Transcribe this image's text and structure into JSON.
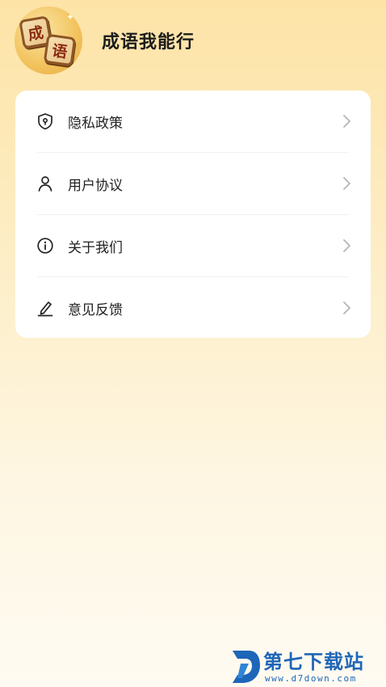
{
  "app": {
    "title": "成语我能行",
    "logo_chars": [
      "成",
      "语"
    ]
  },
  "menu": {
    "items": [
      {
        "label": "隐私政策",
        "icon": "shield-icon"
      },
      {
        "label": "用户协议",
        "icon": "user-icon"
      },
      {
        "label": "关于我们",
        "icon": "info-icon"
      },
      {
        "label": "意见反馈",
        "icon": "edit-icon"
      }
    ]
  },
  "watermark": {
    "brand": "第七下载站",
    "url": "www.d7down.com"
  },
  "colors": {
    "background_top": "#fde3a6",
    "background_bottom": "#fffbf2",
    "card": "#ffffff",
    "watermark": "#1e66b8"
  }
}
